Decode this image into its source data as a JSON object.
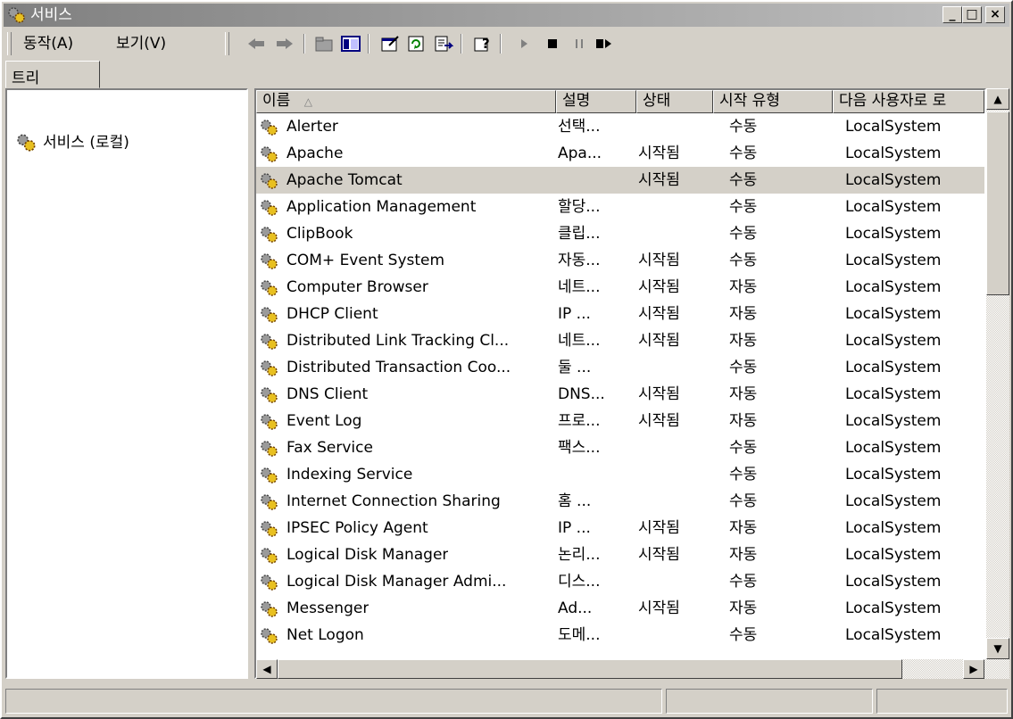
{
  "window": {
    "title": "서비스"
  },
  "menu": {
    "action": "동작(A)",
    "view": "보기(V)"
  },
  "toolbar_icons": [
    "back-arrow-icon",
    "forward-arrow-icon",
    "up-folder-icon",
    "show-tree-icon",
    "properties-icon",
    "refresh-icon",
    "export-list-icon",
    "help-icon",
    "start-icon",
    "stop-icon",
    "pause-icon",
    "restart-icon"
  ],
  "tree": {
    "tab_label": "트리",
    "root": "서비스 (로컬)"
  },
  "columns": {
    "name": "이름",
    "description": "설명",
    "status": "상태",
    "startup": "시작 유형",
    "logon": "다음 사용자로 로"
  },
  "services": [
    {
      "name": "Alerter",
      "description": "선택...",
      "status": "",
      "startup": "수동",
      "logon": "LocalSystem"
    },
    {
      "name": "Apache",
      "description": "Apa...",
      "status": "시작됨",
      "startup": "수동",
      "logon": "LocalSystem"
    },
    {
      "name": "Apache Tomcat",
      "description": "",
      "status": "시작됨",
      "startup": "수동",
      "logon": "LocalSystem",
      "selected": true
    },
    {
      "name": "Application Management",
      "description": "할당...",
      "status": "",
      "startup": "수동",
      "logon": "LocalSystem"
    },
    {
      "name": "ClipBook",
      "description": "클립...",
      "status": "",
      "startup": "수동",
      "logon": "LocalSystem"
    },
    {
      "name": "COM+ Event System",
      "description": "자동...",
      "status": "시작됨",
      "startup": "수동",
      "logon": "LocalSystem"
    },
    {
      "name": "Computer Browser",
      "description": "네트...",
      "status": "시작됨",
      "startup": "자동",
      "logon": "LocalSystem"
    },
    {
      "name": "DHCP Client",
      "description": "IP ...",
      "status": "시작됨",
      "startup": "자동",
      "logon": "LocalSystem"
    },
    {
      "name": "Distributed Link Tracking Cl...",
      "description": "네트...",
      "status": "시작됨",
      "startup": "자동",
      "logon": "LocalSystem"
    },
    {
      "name": "Distributed Transaction Coo...",
      "description": "둘 ...",
      "status": "",
      "startup": "수동",
      "logon": "LocalSystem"
    },
    {
      "name": "DNS Client",
      "description": "DNS...",
      "status": "시작됨",
      "startup": "자동",
      "logon": "LocalSystem"
    },
    {
      "name": "Event Log",
      "description": "프로...",
      "status": "시작됨",
      "startup": "자동",
      "logon": "LocalSystem"
    },
    {
      "name": "Fax Service",
      "description": "팩스...",
      "status": "",
      "startup": "수동",
      "logon": "LocalSystem"
    },
    {
      "name": "Indexing Service",
      "description": "",
      "status": "",
      "startup": "수동",
      "logon": "LocalSystem"
    },
    {
      "name": "Internet Connection Sharing",
      "description": "홈 ...",
      "status": "",
      "startup": "수동",
      "logon": "LocalSystem"
    },
    {
      "name": "IPSEC Policy Agent",
      "description": "IP ...",
      "status": "시작됨",
      "startup": "자동",
      "logon": "LocalSystem"
    },
    {
      "name": "Logical Disk Manager",
      "description": "논리...",
      "status": "시작됨",
      "startup": "자동",
      "logon": "LocalSystem"
    },
    {
      "name": "Logical Disk Manager Admi...",
      "description": "디스...",
      "status": "",
      "startup": "수동",
      "logon": "LocalSystem"
    },
    {
      "name": "Messenger",
      "description": "Ad...",
      "status": "시작됨",
      "startup": "자동",
      "logon": "LocalSystem"
    },
    {
      "name": "Net Logon",
      "description": "도메...",
      "status": "",
      "startup": "수동",
      "logon": "LocalSystem"
    }
  ]
}
